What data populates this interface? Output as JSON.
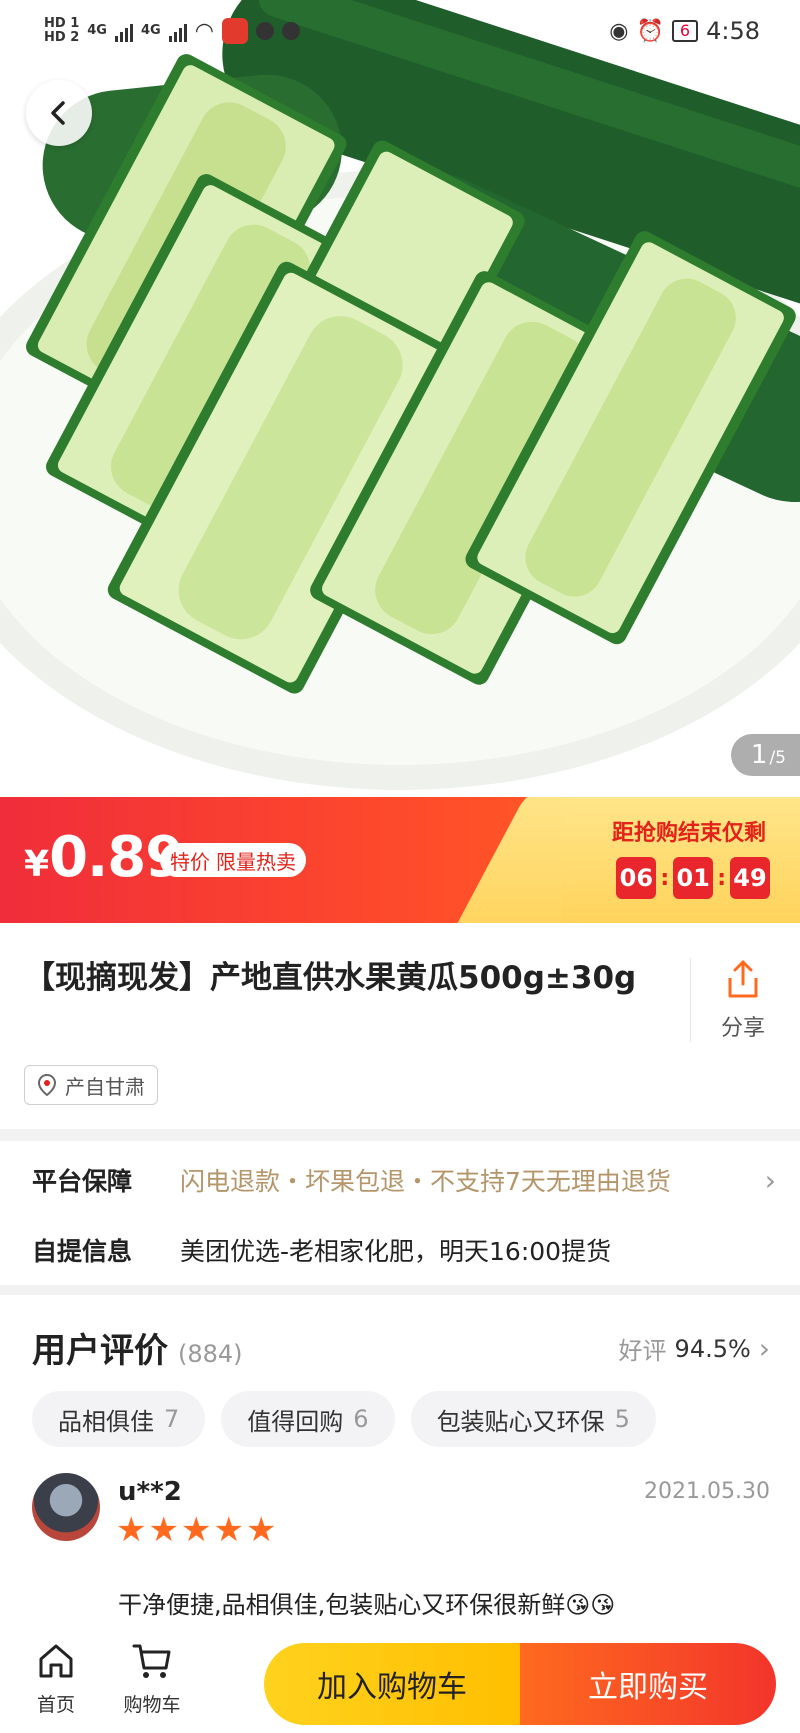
{
  "status_bar": {
    "hd1": "HD 1",
    "hd2": "HD 2",
    "net1": "4G",
    "net2": "4G",
    "battery": "6",
    "time": "4:58"
  },
  "gallery": {
    "current": "1",
    "total": "/5"
  },
  "price": {
    "currency": "¥",
    "amount": "0.89",
    "tag_special": "特价",
    "tag_hot": "限量热卖",
    "countdown_label": "距抢购结束仅剩",
    "countdown": {
      "hours": "06",
      "minutes": "01",
      "seconds": "49"
    }
  },
  "product": {
    "title": "【现摘现发】产地直供水果黄瓜500g±30g",
    "share_label": "分享",
    "origin": "产自甘肃"
  },
  "guarantee": {
    "platform_label": "平台保障",
    "platform_value": "闪电退款・坏果包退・不支持7天无理由退货",
    "pickup_label": "自提信息",
    "pickup_value": "美团优选-老相家化肥，明天16:00提货"
  },
  "reviews": {
    "heading": "用户评价",
    "count": "(884)",
    "good_label": "好评",
    "good_rate": "94.5%",
    "chips": [
      {
        "label": "品相俱佳",
        "count": "7"
      },
      {
        "label": "值得回购",
        "count": "6"
      },
      {
        "label": "包装贴心又环保",
        "count": "5"
      }
    ],
    "items": [
      {
        "user": "u**2",
        "date": "2021.05.30",
        "rating": 5,
        "text": "干净便捷,品相俱佳,包装贴心又环保很新鲜😘😘"
      }
    ]
  },
  "bottom_bar": {
    "home_label": "首页",
    "cart_label": "购物车",
    "add_to_cart": "加入购物车",
    "buy_now": "立即购买"
  },
  "colors": {
    "price_red": "#f02d3a",
    "accent_orange": "#ff6a1f",
    "cart_yellow": "#ffd21e",
    "guarantee_gold": "#b5956a"
  }
}
